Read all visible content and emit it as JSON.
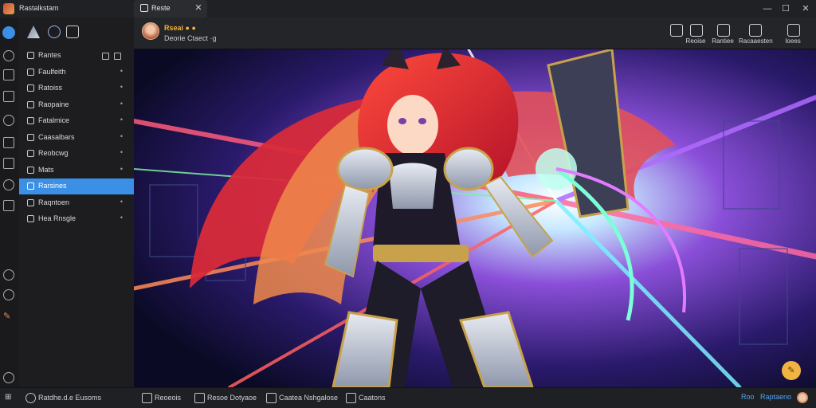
{
  "window": {
    "app_title": "Rastalkstam",
    "tab_title": "Reste",
    "tab_close": "✕",
    "minimize": "—",
    "maximize": "☐",
    "close": "✕"
  },
  "header": {
    "user_name": "Rseai ● ●",
    "user_sub": "Deorie Ctaect ·g",
    "actions": [
      {
        "icon": "star-icon",
        "label": ""
      },
      {
        "icon": "avatar-icon",
        "label": "Reoise"
      },
      {
        "icon": "document-icon",
        "label": "Rantiee"
      },
      {
        "icon": "notification-icon",
        "label": "Racaaesten"
      },
      {
        "icon": "grid-icon",
        "label": "Ioees"
      }
    ]
  },
  "sidebar": {
    "items": [
      {
        "label": "Rantes",
        "icon": "home-icon",
        "chevron": ""
      },
      {
        "label": "Faulfeith",
        "icon": "list-icon",
        "chevron": "•"
      },
      {
        "label": "Ratoiss",
        "icon": "tag-icon",
        "chevron": "•"
      },
      {
        "label": "Raopaine",
        "icon": "chat-icon",
        "chevron": "•"
      },
      {
        "label": "Fatalmice",
        "icon": "file-icon",
        "chevron": "•"
      },
      {
        "label": "Caasalbars",
        "icon": "check-icon",
        "chevron": "•"
      },
      {
        "label": "Reobcwg",
        "icon": "globe-icon",
        "chevron": "•"
      },
      {
        "label": "Mats",
        "icon": "map-icon",
        "chevron": "•"
      },
      {
        "label": "Rarsines",
        "icon": "folder-icon",
        "chevron": "",
        "active": true
      },
      {
        "label": "Raqntoen",
        "icon": "gear-icon",
        "chevron": "•"
      },
      {
        "label": "Hea Rnsgle",
        "icon": "doc-icon",
        "chevron": "•"
      }
    ]
  },
  "bottombar": {
    "status": "Ratdhe.d.e Eusoms",
    "items": [
      {
        "icon": "globe-icon",
        "label": "Reoeois"
      },
      {
        "icon": "pencil-icon",
        "label": "Resoe Dotyaoe"
      },
      {
        "icon": "doc-icon",
        "label": "Caatea Nshgalose"
      },
      {
        "icon": "image-icon",
        "label": "Caatons"
      }
    ],
    "right_items": [
      "Roo",
      "Raptaeno"
    ]
  },
  "fab_icon": "✎",
  "colors": {
    "accent": "#3b8fe5",
    "name_color": "#f0b33c",
    "fab": "#f2b440"
  }
}
